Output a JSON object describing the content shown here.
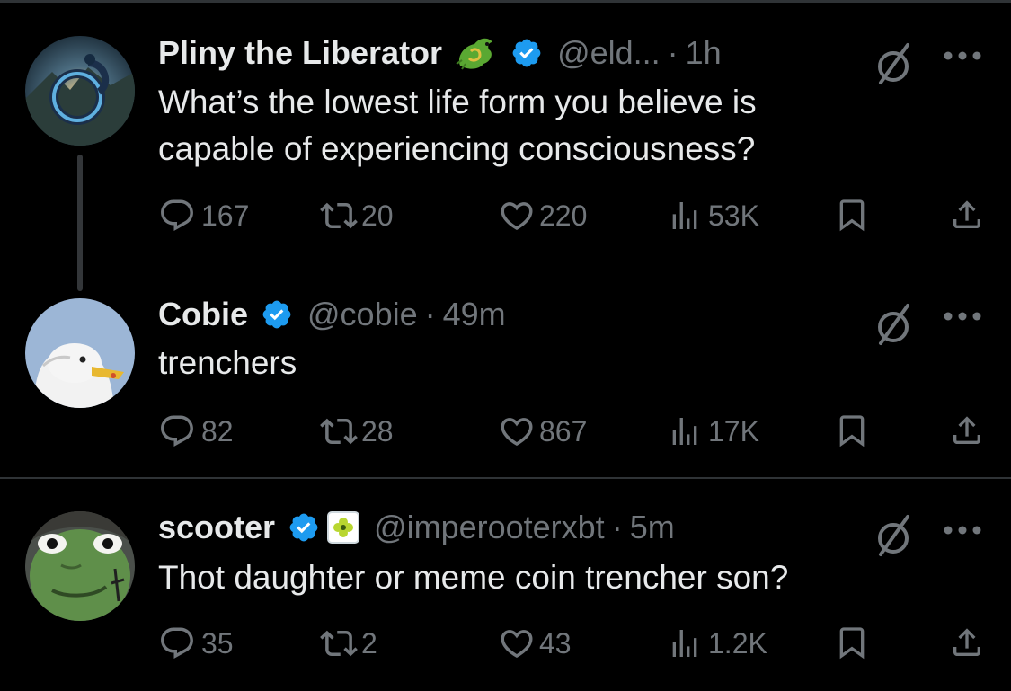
{
  "tweets": [
    {
      "name": "Pliny the Liberator",
      "handle": "@eld...",
      "separator": "·",
      "time": "1h",
      "text_lines": [
        "What’s the lowest life form you believe is",
        "capable of experiencing consciousness?"
      ],
      "stats": {
        "replies": "167",
        "reposts": "20",
        "likes": "220",
        "views": "53K"
      }
    },
    {
      "name": "Cobie",
      "handle": "@cobie",
      "separator": "·",
      "time": "49m",
      "text_lines": [
        "trenchers"
      ],
      "stats": {
        "replies": "82",
        "reposts": "28",
        "likes": "867",
        "views": "17K"
      }
    },
    {
      "name": "scooter",
      "handle": "@imperooterxbt",
      "separator": "·",
      "time": "5m",
      "text_lines": [
        "Thot daughter or meme coin trencher son?"
      ],
      "stats": {
        "replies": "35",
        "reposts": "2",
        "likes": "43",
        "views": "1.2K"
      }
    }
  ],
  "colors": {
    "background": "#000000",
    "text": "#e7e9ea",
    "muted": "#71767b",
    "verified": "#1d9bf0",
    "divider": "#2f3336"
  },
  "icons": [
    "verified-badge-icon",
    "dragon-emoji-icon",
    "affiliate-badge-icon",
    "grok-icon",
    "more-icon",
    "reply-icon",
    "repost-icon",
    "like-icon",
    "views-icon",
    "bookmark-icon",
    "share-icon"
  ]
}
